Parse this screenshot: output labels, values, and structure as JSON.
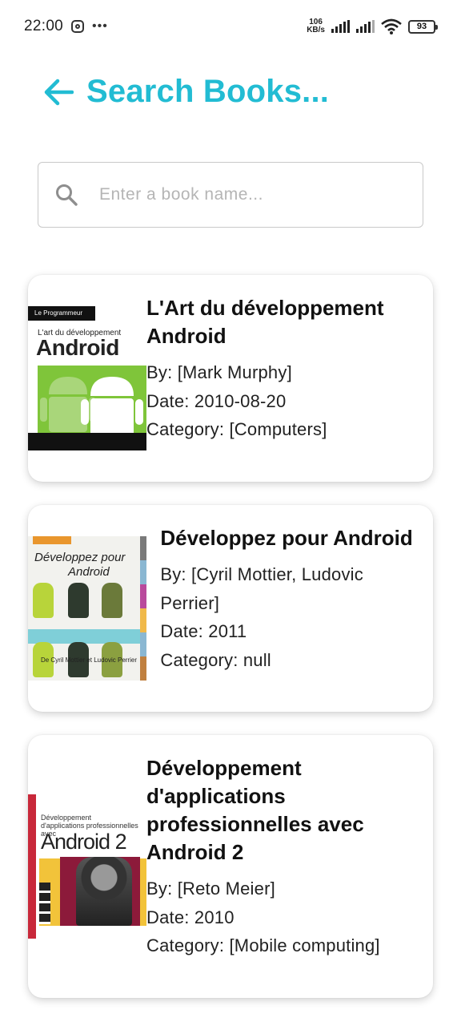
{
  "status_bar": {
    "time": "22:00",
    "speed_value": "106",
    "speed_unit": "KB/s",
    "battery": "93",
    "icons": [
      "instagram-icon",
      "more-dots-icon",
      "signal-icon",
      "wifi-icon",
      "battery-icon"
    ]
  },
  "header": {
    "title": "Search Books..."
  },
  "search": {
    "placeholder": "Enter a book name...",
    "value": ""
  },
  "books": [
    {
      "title": "L'Art du développement Android",
      "authors": "By: [Mark Murphy]",
      "date": "Date: 2010-08-20",
      "category": "Category: [Computers]",
      "cover": {
        "band": "Le Programmeur",
        "subtitle": "L'art du développement",
        "big": "Android"
      }
    },
    {
      "title": "Développez pour Android",
      "authors": "By: [Cyril Mottier, Ludovic Perrier]",
      "date": "Date: 2011",
      "category": "Category: null",
      "cover": {
        "line1": "Développez pour",
        "line2": "Android",
        "authors": "De Cyril Mottier et Ludovic Perrier"
      }
    },
    {
      "title": "Développement d'applications professionnelles avec Android 2",
      "authors": "By: [Reto Meier]",
      "date": "Date: 2010",
      "category": "Category: [Mobile computing]",
      "cover": {
        "line1": "Développement",
        "line2": "d'applications professionnelles avec",
        "big": "Android 2"
      }
    }
  ],
  "colors": {
    "accent": "#22bcd3",
    "android_green": "#7fc53a"
  }
}
